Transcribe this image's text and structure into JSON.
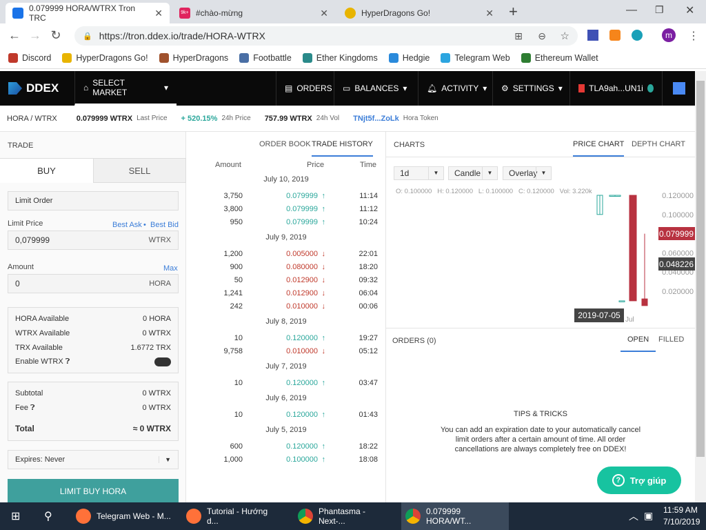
{
  "browser": {
    "tabs": [
      {
        "title": "0.079999 HORA/WTRX Tron TRC",
        "active": true,
        "color": "#1a73e8"
      },
      {
        "title": "#chào-mừng",
        "badge": "9k+",
        "color": "#e0245e"
      },
      {
        "title": "HyperDragons Go!",
        "color": "#e8b400"
      }
    ],
    "new_tab": "+",
    "url": "https://tron.ddex.io/trade/HORA-WTRX",
    "profile": "m",
    "bookmarks": [
      {
        "label": "Discord",
        "color": "#c0392b"
      },
      {
        "label": "HyperDragons Go!",
        "color": "#e8b400"
      },
      {
        "label": "HyperDragons",
        "color": "#a0522d"
      },
      {
        "label": "Footbattle",
        "color": "#4a6fa5"
      },
      {
        "label": "Ether Kingdoms",
        "color": "#2a8a8a"
      },
      {
        "label": "Hedgie",
        "color": "#2a8adb"
      },
      {
        "label": "Telegram Web",
        "color": "#2ca5e0"
      },
      {
        "label": "Ethereum Wallet",
        "color": "#2e7d32"
      }
    ]
  },
  "header": {
    "logo": "DDEX",
    "select_market": "SELECT MARKET",
    "orders": "ORDERS",
    "balances": "BALANCES",
    "activity": "ACTIVITY",
    "settings": "SETTINGS",
    "account": "TLA9ah...UN1i"
  },
  "ticker": {
    "pair": "HORA / WTRX",
    "last_price": "0.079999 WTRX",
    "last_price_label": "Last Price",
    "change": "+ 520.15%",
    "change_label": "24h Price",
    "volume": "757.99 WTRX",
    "volume_label": "24h Vol",
    "token_addr": "TNjt5f...ZoLk",
    "token_name": "Hora Token"
  },
  "trade": {
    "title": "TRADE",
    "buy": "BUY",
    "sell": "SELL",
    "order_type": "Limit Order",
    "limit_price_label": "Limit Price",
    "best_ask": "Best Ask",
    "sep": "•",
    "best_bid": "Best Bid",
    "limit_price": "0,079999",
    "limit_unit": "WTRX",
    "amount_label": "Amount",
    "max": "Max",
    "amount": "0",
    "amount_unit": "HORA",
    "balances": [
      {
        "k": "HORA Available",
        "v": "0 HORA"
      },
      {
        "k": "WTRX Available",
        "v": "0 WTRX"
      },
      {
        "k": "TRX Available",
        "v": "1.6772 TRX"
      }
    ],
    "enable_wtrx": "Enable WTRX",
    "subtotal_label": "Subtotal",
    "subtotal": "0 WTRX",
    "fee_label": "Fee",
    "fee": "0 WTRX",
    "total_label": "Total",
    "total": "≈ 0 WTRX",
    "expires": "Expires: Never",
    "submit": "LIMIT BUY HORA"
  },
  "history": {
    "tabs": [
      "ORDER BOOK",
      "TRADE HISTORY"
    ],
    "cols": [
      "Amount",
      "Price",
      "Time"
    ],
    "groups": [
      {
        "date": "July 10, 2019",
        "rows": [
          [
            "3,750",
            "0.079999",
            "11:14",
            "up"
          ],
          [
            "3,800",
            "0.079999",
            "11:12",
            "up"
          ],
          [
            "950",
            "0.079999",
            "10:24",
            "up"
          ]
        ]
      },
      {
        "date": "July 9, 2019",
        "rows": [
          [
            "1,200",
            "0.005000",
            "22:01",
            "dn"
          ],
          [
            "900",
            "0.080000",
            "18:20",
            "dn"
          ],
          [
            "50",
            "0.012900",
            "09:32",
            "dn"
          ],
          [
            "1,241",
            "0.012900",
            "06:04",
            "dn"
          ],
          [
            "242",
            "0.010000",
            "00:06",
            "dn"
          ]
        ]
      },
      {
        "date": "July 8, 2019",
        "rows": [
          [
            "10",
            "0.120000",
            "19:27",
            "up"
          ],
          [
            "9,758",
            "0.010000",
            "05:12",
            "dn"
          ]
        ]
      },
      {
        "date": "July 7, 2019",
        "rows": [
          [
            "10",
            "0.120000",
            "03:47",
            "up"
          ]
        ]
      },
      {
        "date": "July 6, 2019",
        "rows": [
          [
            "10",
            "0.120000",
            "01:43",
            "up"
          ]
        ]
      },
      {
        "date": "July 5, 2019",
        "rows": [
          [
            "600",
            "0.120000",
            "18:22",
            "up"
          ],
          [
            "1,000",
            "0.100000",
            "18:08",
            "up"
          ]
        ]
      }
    ]
  },
  "charts": {
    "title": "CHARTS",
    "tabs": [
      "PRICE CHART",
      "DEPTH CHART"
    ],
    "interval": "1d",
    "type": "Candle",
    "overlay": "Overlay",
    "ohlc": "O: 0.100000   H: 0.120000   L: 0.100000   C: 0.120000   Vol: 3.220k",
    "last_label": "0.079999",
    "cursor_label": "0.048226",
    "date_label": "2019-07-05",
    "month_label": "Jul"
  },
  "chart_data": {
    "type": "candlestick",
    "ylim": [
      0,
      0.13
    ],
    "yticks": [
      "0.120000",
      "0.100000",
      "0.060000",
      "0.040000",
      "0.020000"
    ],
    "ytick_values": [
      0.12,
      0.1,
      0.06,
      0.04,
      0.02
    ],
    "candles": [
      {
        "date": "2019-07-05",
        "o": 0.1,
        "h": 0.12,
        "l": 0.1,
        "c": 0.12
      },
      {
        "date": "2019-07-06",
        "o": 0.12,
        "h": 0.12,
        "l": 0.12,
        "c": 0.12
      },
      {
        "date": "2019-07-07",
        "o": 0.12,
        "h": 0.12,
        "l": 0.12,
        "c": 0.12
      },
      {
        "date": "2019-07-08",
        "o": 0.12,
        "h": 0.12,
        "l": 0.01,
        "c": 0.01
      },
      {
        "date": "2019-07-09",
        "o": 0.01,
        "h": 0.01,
        "l": 0.01,
        "c": 0.01
      },
      {
        "date": "2019-07-10",
        "o": 0.012,
        "h": 0.08,
        "l": 0.005,
        "c": 0.005
      }
    ]
  },
  "orders": {
    "title": "ORDERS (0)",
    "tabs": [
      "OPEN",
      "FILLED"
    ],
    "tips_title": "TIPS & TRICKS",
    "tips": "You can add an expiration date to your automatically cancel limit orders after a certain amount of time. All order cancellations are always completely free on DDEX!",
    "help": "Trợ giúp"
  },
  "taskbar": {
    "items": [
      "Telegram Web - M...",
      "Tutorial - Hướng d...",
      "Phantasma - Next-...",
      "0.079999 HORA/WT..."
    ],
    "time": "11:59 AM",
    "date": "7/10/2019"
  }
}
